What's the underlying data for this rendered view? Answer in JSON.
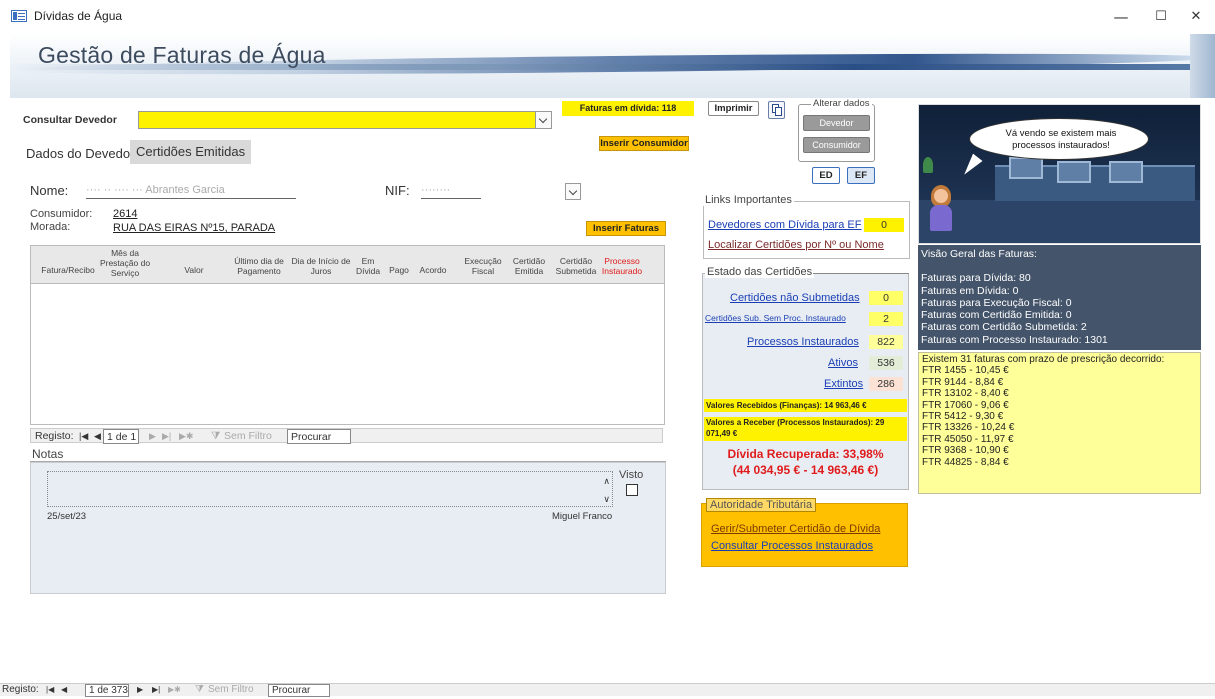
{
  "window": {
    "title": "Dívidas de Água",
    "minimize": "—",
    "maximize": "☐",
    "close": "✕"
  },
  "banner": {
    "title": "Gestão de Faturas de Água"
  },
  "consultar": {
    "label": "Consultar Devedor",
    "value": ""
  },
  "faturas_divida_label": "Faturas em dívida: 118",
  "buttons": {
    "imprimir": "Imprimir",
    "inserir_consumidor": "Inserir Consumidor",
    "inserir_faturas": "Inserir Faturas",
    "ed": "ED",
    "ef": "EF",
    "devedor": "Devedor",
    "consumidor": "Consumidor"
  },
  "alterar_dados": "Alterar dados",
  "tabs": {
    "dados": "Dados do Devedor",
    "certidoes": "Certidões Emitidas"
  },
  "devedor": {
    "nome_label": "Nome:",
    "nome_value": "···· ·· ···· ··· Abrantes Garcia",
    "nif_label": "NIF:",
    "nif_value": "········",
    "consumidor_label": "Consumidor:",
    "consumidor_value": "2614",
    "morada_label": "Morada:",
    "morada_value": "RUA DAS EIRAS Nº15, PARADA"
  },
  "grid": {
    "headers": [
      "Fatura/Recibo",
      "Mês da Prestação do Serviço",
      "Valor",
      "Último dia de Pagamento",
      "Dia de Início de Juros",
      "Em Dívida",
      "Pago",
      "Acordo",
      "Execução Fiscal",
      "Certidão Emitida",
      "Certidão Submetida",
      "Processo Instaurado"
    ]
  },
  "subnav": {
    "registo": "Registo:",
    "current": "1 de 1",
    "filter": "Sem Filtro",
    "search": "Procurar"
  },
  "notas": {
    "label": "Notas",
    "visto": "Visto",
    "date": "25/set/23",
    "author": "Miguel Franco"
  },
  "links": {
    "title": "Links Importantes",
    "devedores_ef": "Devedores com Dívida para EF",
    "devedores_ef_count": "0",
    "localizar": "Localizar Certidões por Nº ou Nome"
  },
  "estado": {
    "title": "Estado das Certidões",
    "nao_submetidas": "Certidões não Submetidas",
    "nao_submetidas_count": "0",
    "sem_proc": "Certidões Sub. Sem Proc. Instaurado",
    "sem_proc_count": "2",
    "processos": "Processos Instaurados",
    "processos_count": "822",
    "ativos": "Ativos",
    "ativos_count": "536",
    "extintos": "Extintos",
    "extintos_count": "286",
    "recebidos": "Valores Recebidos (Finanças): 14 963,46 €",
    "receber": "Valores a Receber (Processos Instaurados): 29 071,49 €",
    "recuperada1": "Dívida Recuperada: 33,98%",
    "recuperada2": "(44 034,95 € - 14 963,46 €)"
  },
  "autoridade": {
    "title": "Autoridade Tributária",
    "gerir": "Gerir/Submeter Certidão de Dívida",
    "consultar": "Consultar Processos Instaurados"
  },
  "speech": "Vá vendo se existem mais processos instaurados!",
  "visao": {
    "title": "Visão Geral das Faturas:",
    "lines": [
      "Faturas para Dívida: 80",
      "Faturas em Dívida: 0",
      "Faturas para Execução Fiscal: 0",
      "Faturas com Certidão Emitida: 0",
      "Faturas com Certidão Submetida: 2",
      "Faturas com Processo Instaurado: 1301"
    ]
  },
  "prescricao": {
    "intro": "Existem 31 faturas com prazo de prescrição decorrido:",
    "items": [
      "FTR 1455 - 10,45 €",
      "FTR 9144 - 8,84 €",
      "FTR 13102 - 8,40 €",
      "FTR 17060 - 9,06 €",
      "FTR 5412 - 9,30 €",
      "FTR 13326 - 10,24 €",
      "FTR 45050 - 11,97 €",
      "FTR 9368 - 10,90 €",
      "FTR 44825 - 8,84 €"
    ]
  },
  "bottomnav": {
    "registo": "Registo:",
    "current": "1 de 373",
    "filter": "Sem Filtro",
    "search": "Procurar"
  },
  "colors": {
    "yellow": "#fff200",
    "orange": "#ffc000",
    "slate": "#44546a",
    "note": "#ffff99",
    "red": "#e01b1b"
  }
}
